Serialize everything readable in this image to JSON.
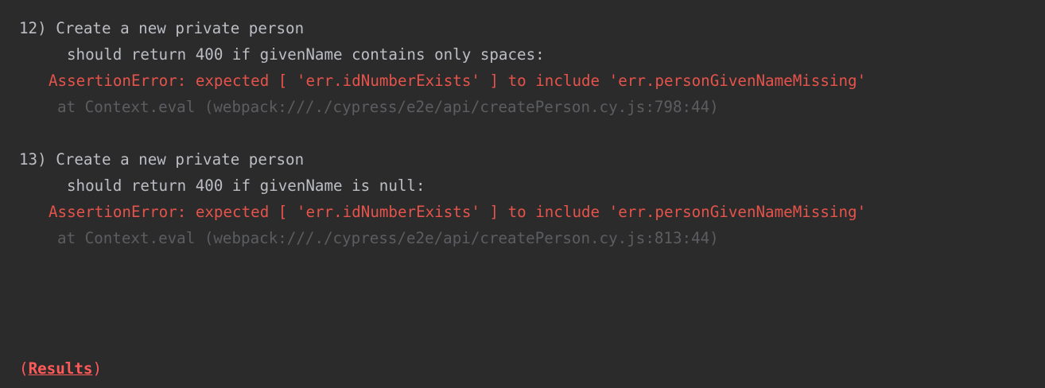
{
  "failures": [
    {
      "number": "12)",
      "title": "Create a new private person",
      "test": "should return 400 if givenName contains only spaces:",
      "error": "AssertionError: expected [ 'err.idNumberExists' ] to include 'err.personGivenNameMissing'",
      "trace": "at Context.eval (webpack:///./cypress/e2e/api/createPerson.cy.js:798:44)"
    },
    {
      "number": "13)",
      "title": "Create a new private person",
      "test": "should return 400 if givenName is null:",
      "error": "AssertionError: expected [ 'err.idNumberExists' ] to include 'err.personGivenNameMissing'",
      "trace": "at Context.eval (webpack:///./cypress/e2e/api/createPerson.cy.js:813:44)"
    }
  ],
  "results": {
    "open_paren": "(",
    "label": "Results",
    "close_paren": ")"
  },
  "colors": {
    "background": "#2b2b2b",
    "text": "#bcbec4",
    "error": "#e5534b",
    "trace": "#5c5d61",
    "link": "#ff5a5a"
  }
}
